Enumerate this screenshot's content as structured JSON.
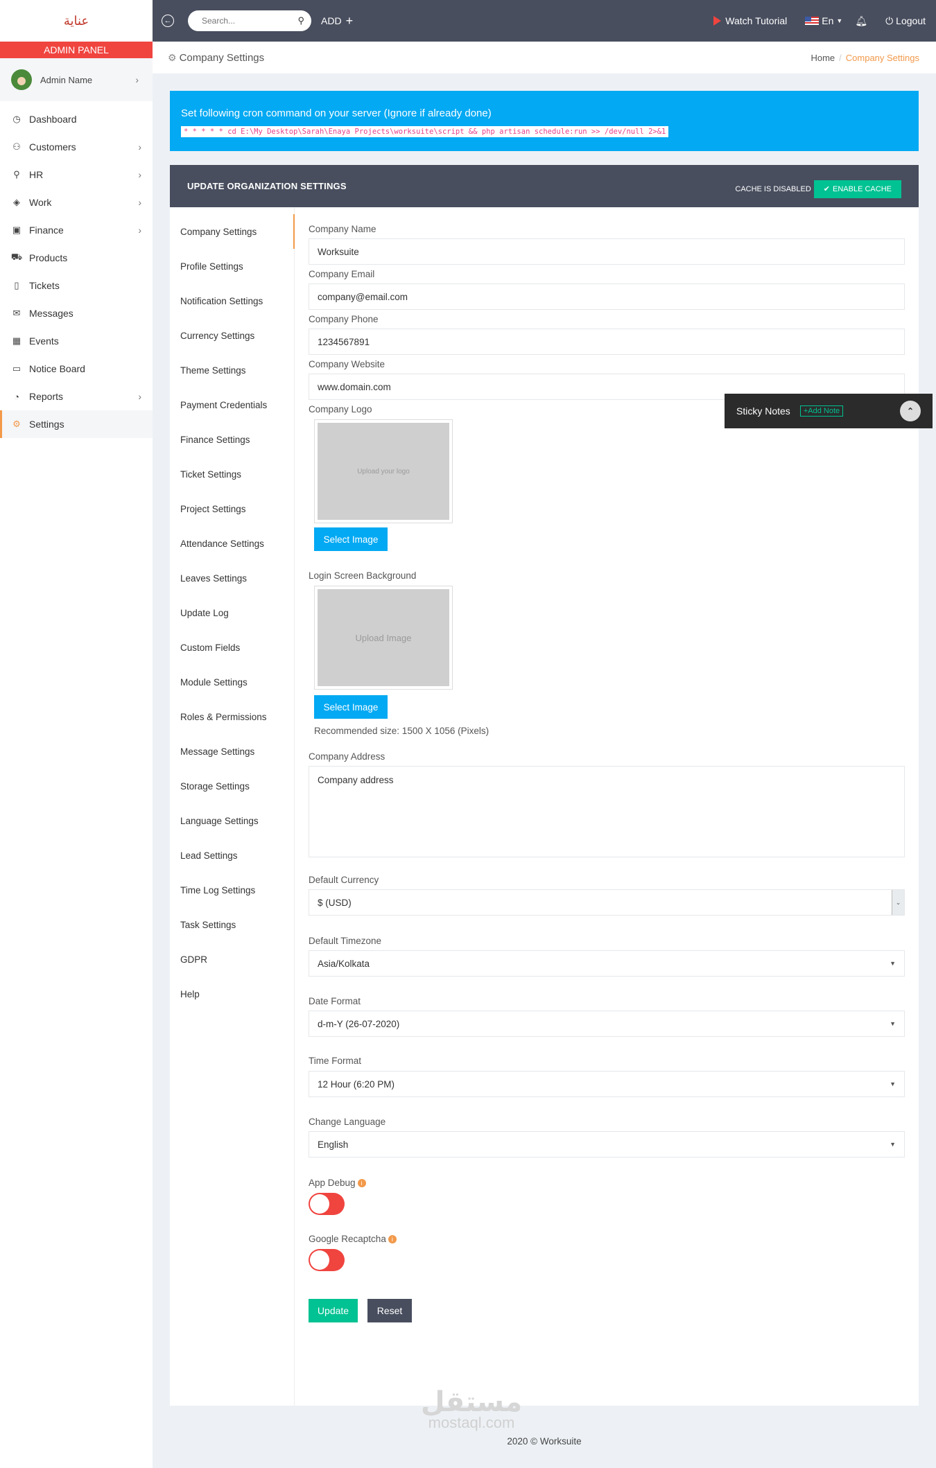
{
  "brand": {
    "logo_text": "عناية",
    "admin_panel": "ADMIN PANEL"
  },
  "user": {
    "name": "Admin Name"
  },
  "nav": [
    {
      "label": "Dashboard",
      "icon": "dashboard-icon",
      "glyph": "◷",
      "has_children": false
    },
    {
      "label": "Customers",
      "icon": "customers-icon",
      "glyph": "⚇",
      "has_children": true
    },
    {
      "label": "HR",
      "icon": "hr-icon",
      "glyph": "⚲",
      "has_children": true
    },
    {
      "label": "Work",
      "icon": "work-icon",
      "glyph": "◈",
      "has_children": true
    },
    {
      "label": "Finance",
      "icon": "finance-icon",
      "glyph": "▣",
      "has_children": true
    },
    {
      "label": "Products",
      "icon": "cart-icon",
      "glyph": "⛟",
      "has_children": false
    },
    {
      "label": "Tickets",
      "icon": "ticket-icon",
      "glyph": "▯",
      "has_children": false
    },
    {
      "label": "Messages",
      "icon": "envelope-icon",
      "glyph": "✉",
      "has_children": false
    },
    {
      "label": "Events",
      "icon": "calendar-icon",
      "glyph": "▦",
      "has_children": false
    },
    {
      "label": "Notice Board",
      "icon": "laptop-icon",
      "glyph": "▭",
      "has_children": false
    },
    {
      "label": "Reports",
      "icon": "pie-chart-icon",
      "glyph": "◔",
      "has_children": true
    },
    {
      "label": "Settings",
      "icon": "gear-icon",
      "glyph": "⚙",
      "has_children": false,
      "active": true
    }
  ],
  "topbar": {
    "search_placeholder": "Search...",
    "add_label": "ADD",
    "watch_tutorial": "Watch Tutorial",
    "language": "En",
    "logout": "Logout"
  },
  "page": {
    "title": "Company Settings",
    "breadcrumb_home": "Home",
    "breadcrumb_current": "Company Settings"
  },
  "cron": {
    "title": "Set following cron command on your server (Ignore if already done)",
    "command": "* * * * * cd E:\\My Desktop\\Sarah\\Enaya Projects\\worksuite\\script && php artisan schedule:run >> /dev/null 2>&1"
  },
  "card": {
    "title": "UPDATE ORGANIZATION SETTINGS",
    "cache_status": "CACHE IS DISABLED",
    "enable_cache": "ENABLE CACHE"
  },
  "tabs": [
    "Company Settings",
    "Profile Settings",
    "Notification Settings",
    "Currency Settings",
    "Theme Settings",
    "Payment Credentials",
    "Finance Settings",
    "Ticket Settings",
    "Project Settings",
    "Attendance Settings",
    "Leaves Settings",
    "Update Log",
    "Custom Fields",
    "Module Settings",
    "Roles & Permissions",
    "Message Settings",
    "Storage Settings",
    "Language Settings",
    "Lead Settings",
    "Time Log Settings",
    "Task Settings",
    "GDPR",
    "Help"
  ],
  "form": {
    "company_name_label": "Company Name",
    "company_name": "Worksuite",
    "company_email_label": "Company Email",
    "company_email": "company@email.com",
    "company_phone_label": "Company Phone",
    "company_phone": "1234567891",
    "company_website_label": "Company Website",
    "company_website": "www.domain.com",
    "logo_label": "Company Logo",
    "logo_placeholder": "Upload your logo",
    "select_image": "Select Image",
    "login_bg_label": "Login Screen Background",
    "login_bg_placeholder": "Upload Image",
    "recommended_size": "Recommended size: 1500 X 1056 (Pixels)",
    "address_label": "Company Address",
    "address": "Company address",
    "currency_label": "Default Currency",
    "currency": "$ (USD)",
    "timezone_label": "Default Timezone",
    "timezone": "Asia/Kolkata",
    "date_format_label": "Date Format",
    "date_format": "d-m-Y (26-07-2020)",
    "time_format_label": "Time Format",
    "time_format": "12 Hour (6:20 PM)",
    "language_label": "Change Language",
    "language": "English",
    "app_debug_label": "App Debug",
    "recaptcha_label": "Google Recaptcha",
    "update": "Update",
    "reset": "Reset"
  },
  "sticky": {
    "title": "Sticky Notes",
    "add_note": "Add Note"
  },
  "footer": {
    "text": "2020 © Worksuite"
  },
  "watermark": {
    "arabic": "مستقل",
    "latin": "mostaql.com"
  },
  "colors": {
    "accent": "#f2994a",
    "topbar": "#484e5e",
    "info": "#03a9f3",
    "success": "#00c292",
    "danger": "#f0443f"
  }
}
